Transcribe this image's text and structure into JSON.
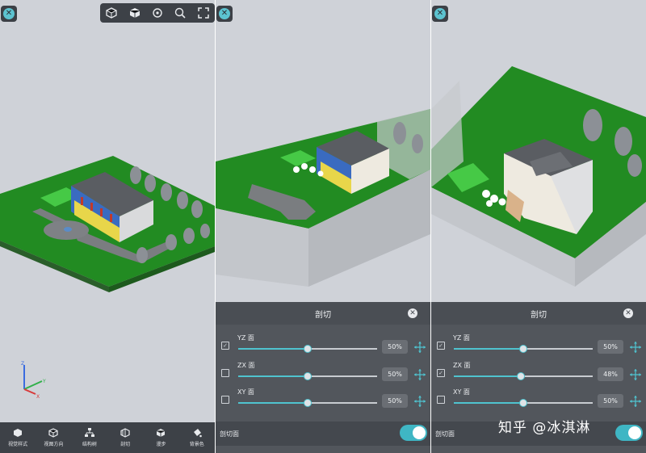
{
  "top_toolbar": {
    "icons": [
      "home-view-icon",
      "perspective-cube-icon",
      "rotate-icon",
      "zoom-icon",
      "fullscreen-icon"
    ]
  },
  "bottom_toolbar": {
    "items": [
      {
        "label": "视觉样式",
        "icon": "visual-style-icon"
      },
      {
        "label": "视图方向",
        "icon": "view-direction-icon"
      },
      {
        "label": "结构树",
        "icon": "structure-tree-icon"
      },
      {
        "label": "剖切",
        "icon": "section-icon"
      },
      {
        "label": "漫步",
        "icon": "walk-icon"
      },
      {
        "label": "背景色",
        "icon": "background-color-icon"
      }
    ]
  },
  "axes": {
    "z": "Z",
    "y": "Y",
    "x": "X"
  },
  "section_panels": [
    {
      "title": "剖切",
      "rows": [
        {
          "plane": "YZ 面",
          "percent": "50%",
          "value": 0.5,
          "checked": true
        },
        {
          "plane": "ZX 面",
          "percent": "50%",
          "value": 0.5,
          "checked": false
        },
        {
          "plane": "XY 面",
          "percent": "50%",
          "value": 0.5,
          "checked": false
        }
      ],
      "footer_label": "剖切面",
      "toggle_on": true
    },
    {
      "title": "剖切",
      "rows": [
        {
          "plane": "YZ 面",
          "percent": "50%",
          "value": 0.5,
          "checked": true
        },
        {
          "plane": "ZX 面",
          "percent": "48%",
          "value": 0.48,
          "checked": true
        },
        {
          "plane": "XY 面",
          "percent": "50%",
          "value": 0.5,
          "checked": false
        }
      ],
      "footer_label": "剖切面",
      "toggle_on": true
    }
  ],
  "watermark": "知乎 @冰淇淋",
  "colors": {
    "accent": "#4fc3cf",
    "toolbar": "#3d4147",
    "grass": "#1f8a1f",
    "background": "#d3d6dc"
  }
}
